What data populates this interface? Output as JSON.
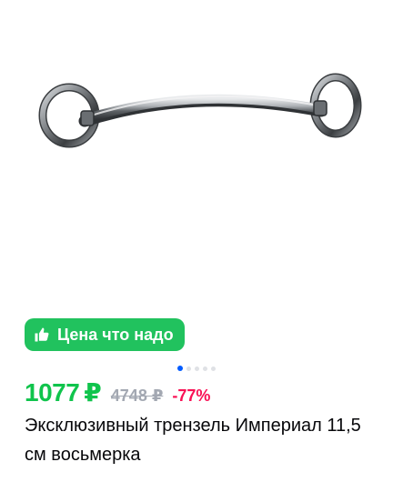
{
  "product": {
    "image_alt": "Эксклюзивный трензель Империал 11,5 см восьмерка",
    "badge_icon": "thumbs-up-icon",
    "badge_label": "Цена что надо",
    "carousel": {
      "count": 5,
      "active_index": 0
    },
    "price": {
      "current": "1077",
      "current_currency": "₽",
      "old": "4748 ₽",
      "discount": "-77%"
    },
    "title": "Эксклюзивный трензель Империал 11,5 см восьмерка"
  },
  "colors": {
    "badge_bg": "#21c25e",
    "price_green": "#10c44c",
    "discount_pink": "#f91155",
    "old_price_gray": "#a3a8b2",
    "dot_active": "#005bff",
    "dot_inactive": "#dfe1e5"
  }
}
